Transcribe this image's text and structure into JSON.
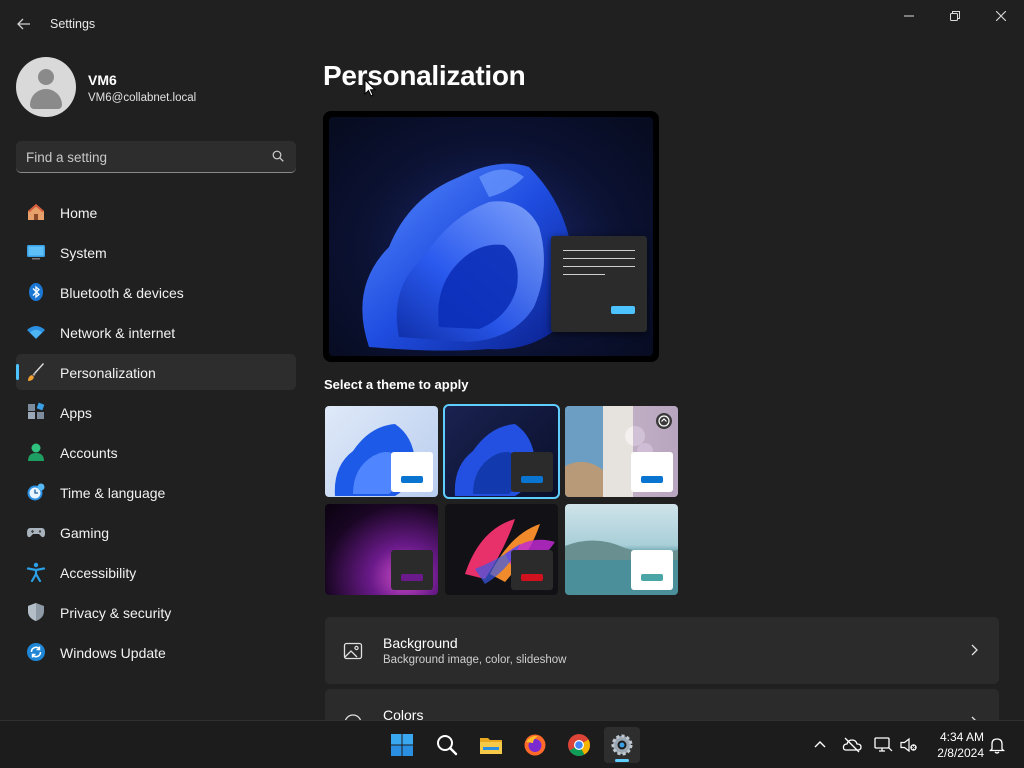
{
  "window": {
    "title": "Settings",
    "controls": [
      "minimize",
      "restore",
      "close"
    ]
  },
  "user": {
    "name": "VM6",
    "email": "VM6@collabnet.local"
  },
  "search": {
    "placeholder": "Find a setting"
  },
  "sidebar": {
    "items": [
      {
        "label": "Home",
        "icon": "home-icon"
      },
      {
        "label": "System",
        "icon": "system-icon"
      },
      {
        "label": "Bluetooth & devices",
        "icon": "bluetooth-icon"
      },
      {
        "label": "Network & internet",
        "icon": "wifi-icon"
      },
      {
        "label": "Personalization",
        "icon": "paintbrush-icon",
        "active": true
      },
      {
        "label": "Apps",
        "icon": "apps-icon"
      },
      {
        "label": "Accounts",
        "icon": "accounts-icon"
      },
      {
        "label": "Time & language",
        "icon": "clock-globe-icon"
      },
      {
        "label": "Gaming",
        "icon": "gamepad-icon"
      },
      {
        "label": "Accessibility",
        "icon": "accessibility-icon"
      },
      {
        "label": "Privacy & security",
        "icon": "shield-icon"
      },
      {
        "label": "Windows Update",
        "icon": "update-icon"
      }
    ],
    "accent": "#4cc2ff"
  },
  "main": {
    "title": "Personalization",
    "theme_section_label": "Select a theme to apply",
    "themes": [
      {
        "name": "light-bloom",
        "selected": false,
        "accent": "#0a74d1"
      },
      {
        "name": "dark-bloom",
        "selected": true,
        "accent": "#0a74d1"
      },
      {
        "name": "spotlight",
        "selected": false,
        "accent": "#0a74d1"
      },
      {
        "name": "glow",
        "selected": false,
        "accent": "#6a1a8a"
      },
      {
        "name": "captured-motion",
        "selected": false,
        "accent": "#d0121e"
      },
      {
        "name": "flow",
        "selected": false,
        "accent": "#4aa6a6"
      }
    ],
    "cards": [
      {
        "title": "Background",
        "subtitle": "Background image, color, slideshow",
        "icon": "image-icon"
      },
      {
        "title": "Colors",
        "subtitle": "",
        "icon": "palette-icon"
      }
    ]
  },
  "taskbar": {
    "apps": [
      "start-icon",
      "search-icon",
      "file-explorer-icon",
      "firefox-icon",
      "chrome-icon",
      "settings-icon"
    ],
    "active_app": "settings-icon",
    "time": "4:34 AM",
    "date": "2/8/2024"
  }
}
